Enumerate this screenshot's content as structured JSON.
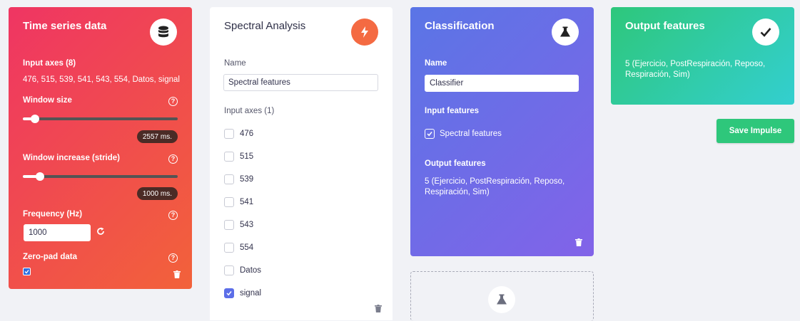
{
  "time_series": {
    "title": "Time series data",
    "icon": "database-icon",
    "input_axes_label": "Input axes (8)",
    "input_axes_value": "476, 515, 539, 541, 543, 554, Datos, signal",
    "window_size_label": "Window size",
    "window_size_value": "2557 ms.",
    "window_size_fraction": 0.08,
    "window_increase_label": "Window increase (stride)",
    "window_increase_value": "1000 ms.",
    "window_increase_fraction": 0.11,
    "frequency_label": "Frequency (Hz)",
    "frequency_value": "1000",
    "zero_pad_label": "Zero-pad data",
    "zero_pad_checked": true,
    "help_glyph": "?",
    "colors": {
      "from": "#ef3563",
      "to": "#f2623a"
    }
  },
  "spectral": {
    "title": "Spectral Analysis",
    "icon": "lightning-icon",
    "name_label": "Name",
    "name_value": "Spectral features",
    "input_axes_label": "Input axes (1)",
    "axes": [
      {
        "label": "476",
        "checked": false
      },
      {
        "label": "515",
        "checked": false
      },
      {
        "label": "539",
        "checked": false
      },
      {
        "label": "541",
        "checked": false
      },
      {
        "label": "543",
        "checked": false
      },
      {
        "label": "554",
        "checked": false
      },
      {
        "label": "Datos",
        "checked": false
      },
      {
        "label": "signal",
        "checked": true
      }
    ],
    "accent": "#f46a42"
  },
  "classification": {
    "title": "Classification",
    "icon": "flask-icon",
    "name_label": "Name",
    "name_value": "Classifier",
    "input_features_label": "Input features",
    "input_feature": "Spectral features",
    "input_feature_checked": true,
    "output_features_label": "Output features",
    "output_features_value": "5 (Ejercicio, PostRespiración, Reposo, Respiración, Sim)",
    "colors": {
      "from": "#5a75e6",
      "to": "#8263e8"
    }
  },
  "add_block": {
    "icon": "flask-icon"
  },
  "output": {
    "title": "Output features",
    "icon": "check-icon",
    "value": "5 (Ejercicio, PostRespiración, Reposo, Respiración, Sim)",
    "colors": {
      "from": "#2ec77b",
      "to": "#33cfd0"
    }
  },
  "save_button": {
    "label": "Save Impulse",
    "color": "#2ec77b"
  }
}
